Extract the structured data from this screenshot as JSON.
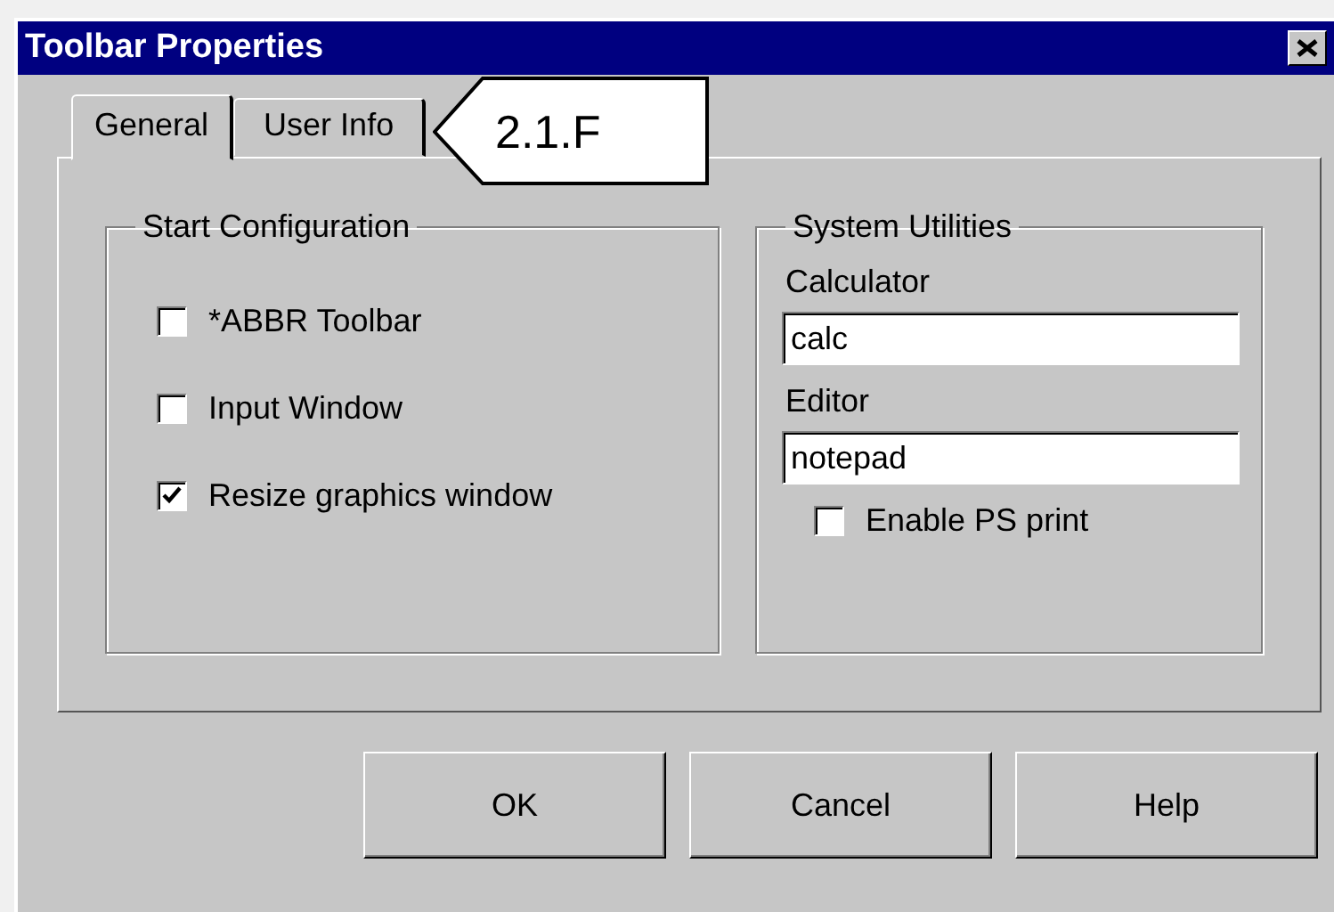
{
  "window": {
    "title": "Toolbar Properties"
  },
  "tabs": [
    {
      "label": "General",
      "selected": true
    },
    {
      "label": "User Info",
      "selected": false
    }
  ],
  "callout": {
    "text": "2.1.F"
  },
  "start_configuration": {
    "title": "Start Configuration",
    "options": [
      {
        "label": "*ABBR Toolbar",
        "checked": false
      },
      {
        "label": "Input Window",
        "checked": false
      },
      {
        "label": "Resize graphics window",
        "checked": true
      }
    ]
  },
  "system_utilities": {
    "title": "System Utilities",
    "fields": [
      {
        "label": "Calculator",
        "value": "calc"
      },
      {
        "label": "Editor",
        "value": "notepad"
      }
    ],
    "option": {
      "label": "Enable PS print",
      "checked": false
    }
  },
  "buttons": [
    "OK",
    "Cancel",
    "Help"
  ]
}
